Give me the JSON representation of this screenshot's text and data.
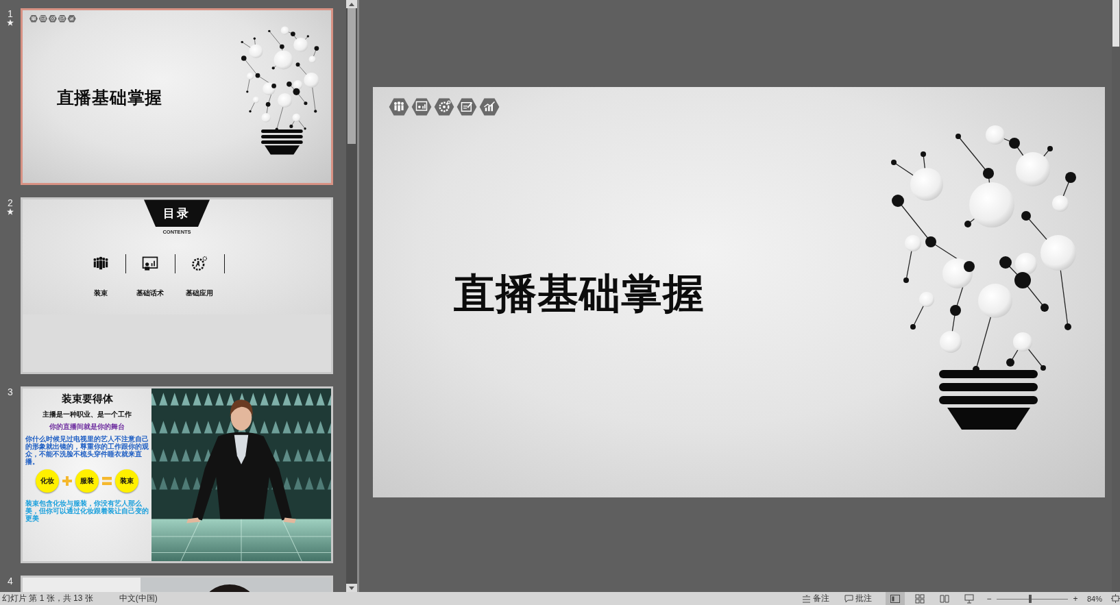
{
  "slide_panel": {
    "thumbnails": [
      {
        "number": "1",
        "selected": true,
        "animated": true,
        "kind": "title",
        "title": "直播基础掌握"
      },
      {
        "number": "2",
        "selected": false,
        "animated": true,
        "kind": "contents",
        "heading": "目录",
        "subheading": "CONTENTS",
        "items": [
          {
            "label": "装束",
            "kind": "people"
          },
          {
            "label": "基础话术",
            "kind": "presentation"
          },
          {
            "label": "基础应用",
            "kind": "gear"
          }
        ]
      },
      {
        "number": "3",
        "selected": false,
        "animated": false,
        "kind": "photo-text",
        "title": "装束要得体",
        "line_1": "主播是一种职业、是一个工作",
        "line_2": "你的直播间就是你的舞台",
        "paragraph": "你什么时候见过电视里的艺人不注意自己的形象就出镜的，尊重你的工作跟你的观众，不能不洗脸不梳头穿件睡衣就来直播。",
        "equation": [
          "化妆",
          "服装",
          "装束"
        ],
        "footer": "装束包含化妆与服装，你没有艺人那么美，但你可以通过化妆跟着装让自己变的更美"
      },
      {
        "number": "4",
        "selected": false,
        "animated": false,
        "kind": "partial"
      }
    ]
  },
  "slide": {
    "title": "直播基础掌握"
  },
  "status_bar": {
    "slide_info": "幻灯片 第 1 张，共 13 张",
    "language": "中文(中国)",
    "notes": "备注",
    "comments": "批注",
    "views": [
      {
        "kind": "normal",
        "selected": true
      },
      {
        "kind": "sorter",
        "selected": false
      },
      {
        "kind": "reading",
        "selected": false
      },
      {
        "kind": "slideshow",
        "selected": false
      }
    ],
    "zoom": {
      "minus": "−",
      "plus": "+",
      "level": 0.47,
      "value": "84%"
    }
  }
}
